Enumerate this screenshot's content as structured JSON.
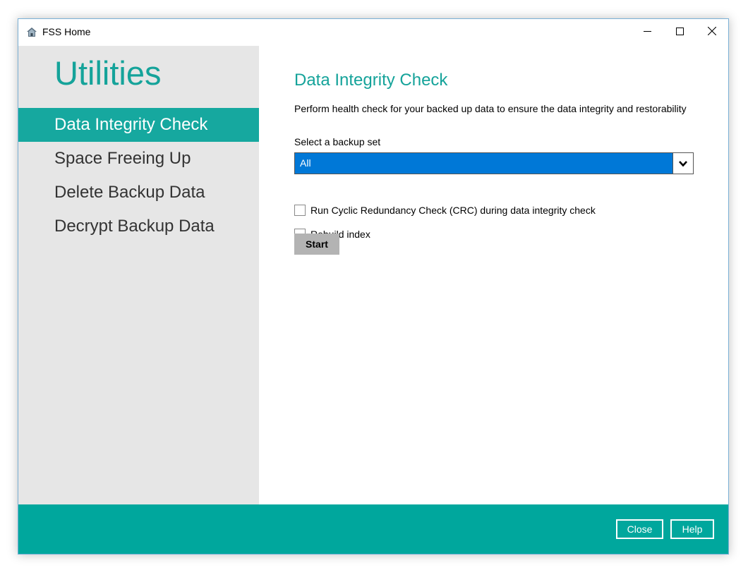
{
  "window": {
    "title": "FSS Home",
    "app_icon": "house-icon",
    "controls": {
      "minimize": "minimize-icon",
      "maximize": "maximize-icon",
      "close": "close-icon"
    }
  },
  "sidebar": {
    "title": "Utilities",
    "items": [
      {
        "label": "Data Integrity Check",
        "active": true
      },
      {
        "label": "Space Freeing Up",
        "active": false
      },
      {
        "label": "Delete Backup Data",
        "active": false
      },
      {
        "label": "Decrypt Backup Data",
        "active": false
      }
    ]
  },
  "main": {
    "title": "Data Integrity Check",
    "description": "Perform health check for your backed up data to ensure the data integrity and restorability",
    "backup_set": {
      "label": "Select a backup set",
      "selected": "All",
      "arrow_icon": "chevron-down-icon"
    },
    "options": [
      {
        "label": "Run Cyclic Redundancy Check (CRC) during data integrity check",
        "checked": false
      },
      {
        "label": "Rebuild index",
        "checked": false
      }
    ],
    "start_label": "Start"
  },
  "footer": {
    "close_label": "Close",
    "help_label": "Help"
  },
  "colors": {
    "accent": "#16a89f",
    "footer": "#00a79d",
    "select_highlight": "#0078d7",
    "sidebar_bg": "#e6e6e6"
  }
}
